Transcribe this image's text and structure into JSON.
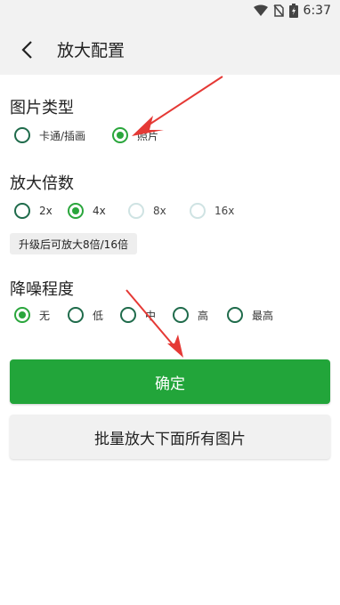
{
  "status_bar": {
    "time": "6:37"
  },
  "header": {
    "title": "放大配置"
  },
  "image_type": {
    "title": "图片类型",
    "options": [
      {
        "label": "卡通/插画",
        "checked": false
      },
      {
        "label": "照片",
        "checked": true
      }
    ]
  },
  "scale": {
    "title": "放大倍数",
    "options": [
      {
        "label": "2x",
        "checked": false,
        "enabled": true
      },
      {
        "label": "4x",
        "checked": true,
        "enabled": true
      },
      {
        "label": "8x",
        "checked": false,
        "enabled": false
      },
      {
        "label": "16x",
        "checked": false,
        "enabled": false
      }
    ],
    "upgrade_text": "升级后可放大8倍/16倍"
  },
  "denoise": {
    "title": "降噪程度",
    "options": [
      {
        "label": "无",
        "checked": true
      },
      {
        "label": "低",
        "checked": false
      },
      {
        "label": "中",
        "checked": false
      },
      {
        "label": "高",
        "checked": false
      },
      {
        "label": "最高",
        "checked": false
      }
    ]
  },
  "actions": {
    "confirm_label": "确定",
    "batch_label": "批量放大下面所有图片"
  },
  "colors": {
    "accent": "#22a53a",
    "radio_border": "#1f6b4b",
    "annotation": "#e53935"
  }
}
